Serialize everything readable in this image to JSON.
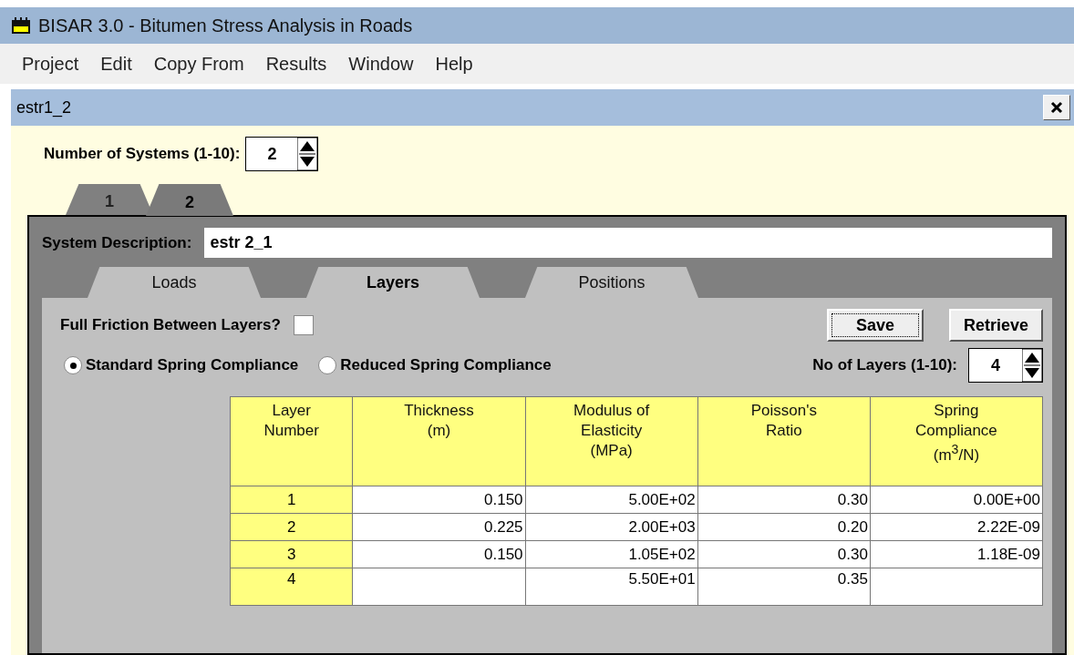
{
  "window": {
    "title": "BISAR 3.0 - Bitumen Stress Analysis in Roads"
  },
  "menu": [
    "Project",
    "Edit",
    "Copy From",
    "Results",
    "Window",
    "Help"
  ],
  "document": {
    "title": "estr1_2"
  },
  "systems": {
    "label": "Number of Systems (1-10):",
    "value": "2"
  },
  "system_tabs": [
    {
      "label": "1",
      "selected": false
    },
    {
      "label": "2",
      "selected": true
    }
  ],
  "description": {
    "label": "System Description:",
    "value": "estr 2_1"
  },
  "tabs": [
    {
      "label": "Loads",
      "selected": false
    },
    {
      "label": "Layers",
      "selected": true
    },
    {
      "label": "Positions",
      "selected": false
    }
  ],
  "friction": {
    "label": "Full Friction Between Layers?",
    "checked": false
  },
  "buttons": [
    {
      "label": "Save",
      "focused": true
    },
    {
      "label": "Retrieve",
      "focused": false
    }
  ],
  "compliance": [
    {
      "label": "Standard Spring Compliance",
      "selected": true
    },
    {
      "label": "Reduced Spring Compliance",
      "selected": false
    }
  ],
  "layers": {
    "label": "No of Layers (1-10):",
    "value": "4"
  },
  "table": {
    "columns": [
      "Layer\nNumber",
      "Thickness\n(m)",
      "Modulus of\nElasticity\n(MPa)",
      "Poisson's\nRatio",
      "Spring\nCompliance\n(m$^{3}$/N)"
    ],
    "rows": [
      [
        "1",
        "0.150",
        "5.00E+02",
        "0.30",
        "0.00E+00"
      ],
      [
        "2",
        "0.225",
        "2.00E+03",
        "0.20",
        "2.22E-09"
      ],
      [
        "3",
        "0.150",
        "1.05E+02",
        "0.30",
        "1.18E-09"
      ],
      [
        "4",
        null,
        "5.50E+01",
        "0.35",
        null
      ]
    ]
  }
}
